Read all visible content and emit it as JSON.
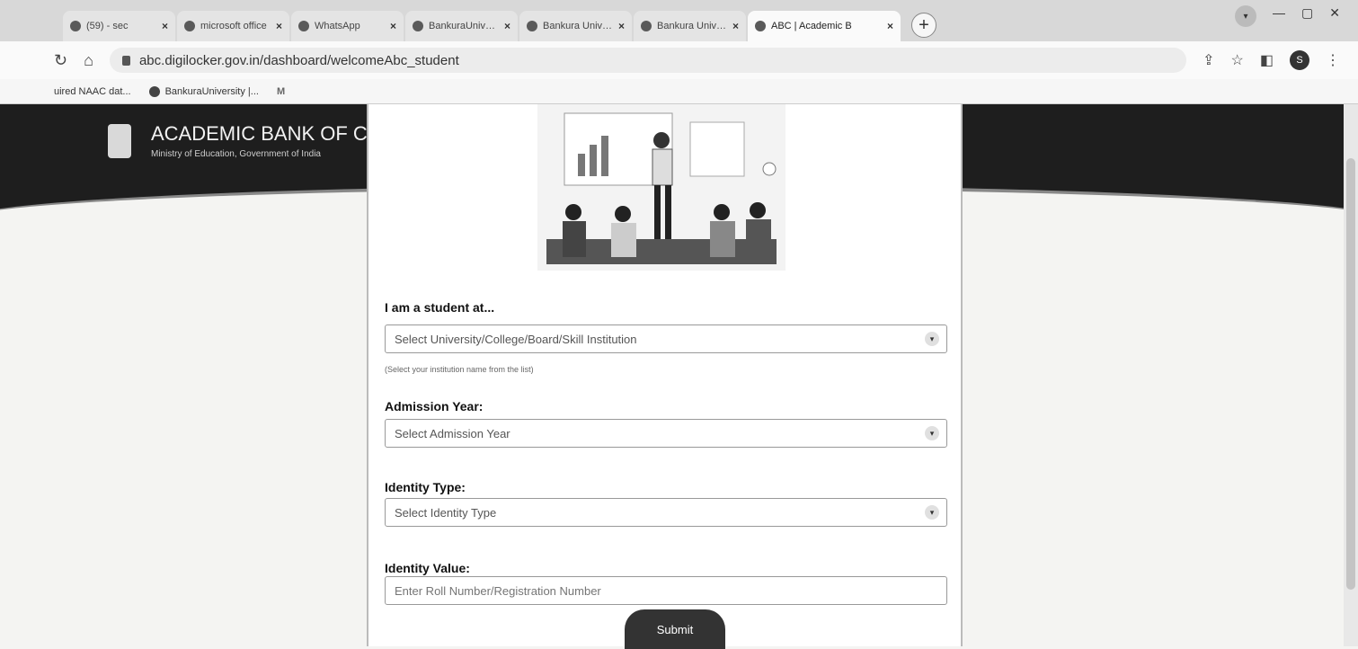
{
  "browser": {
    "tabs": [
      {
        "label": "(59) - sec",
        "active": false
      },
      {
        "label": "microsoft office",
        "active": false
      },
      {
        "label": "WhatsApp",
        "active": false
      },
      {
        "label": "BankuraUniversi",
        "active": false
      },
      {
        "label": "Bankura Univers",
        "active": false
      },
      {
        "label": "Bankura Universi",
        "active": false
      },
      {
        "label": "ABC | Academic B",
        "active": true
      }
    ],
    "tab_close": "×",
    "new_tab": "+",
    "url": "abc.digilocker.gov.in/dashboard/welcomeAbc_student",
    "profile_initial": "S",
    "bookmarks": [
      "uired NAAC dat...",
      "BankuraUniversity |..."
    ],
    "bookmark_gmail": "M"
  },
  "header": {
    "title": "ACADEMIC BANK OF C",
    "subtitle": "Ministry of Education, Government of India"
  },
  "form": {
    "institution_label": "I am a student at...",
    "institution_placeholder": "Select University/College/Board/Skill Institution",
    "institution_hint": "(Select your institution name from the list)",
    "admission_year_label": "Admission Year:",
    "admission_year_placeholder": "Select Admission Year",
    "identity_type_label": "Identity Type:",
    "identity_type_placeholder": "Select Identity Type",
    "identity_value_label": "Identity Value:",
    "identity_value_placeholder": "Enter Roll Number/Registration Number",
    "submit_label": "Submit"
  },
  "colors": {
    "header_bg": "#1e1e1e",
    "submit_bg": "#333333"
  }
}
